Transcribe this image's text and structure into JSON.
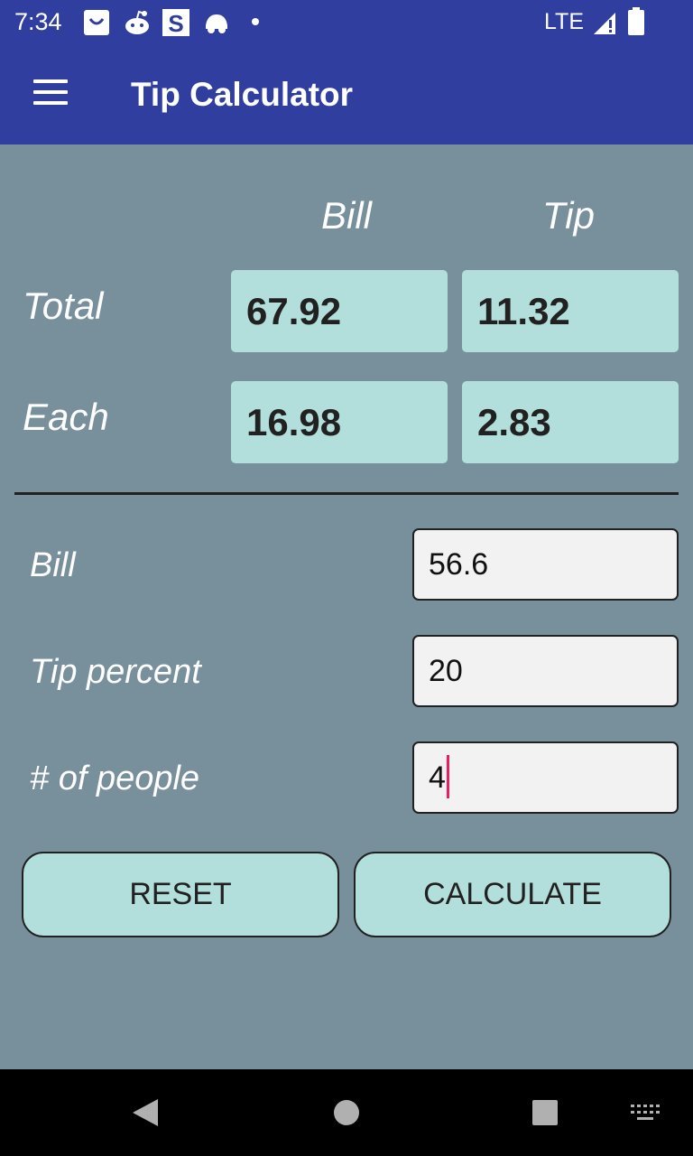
{
  "status_bar": {
    "time": "7:34",
    "notification_icons": [
      "shopping-bag-icon",
      "reddit-icon",
      "s-app-icon",
      "car-icon",
      "dot-icon"
    ],
    "network": "LTE",
    "signal_icon": "signal-icon",
    "battery_icon": "battery-icon"
  },
  "app_bar": {
    "menu_icon": "hamburger-menu-icon",
    "title": "Tip Calculator"
  },
  "results": {
    "col_bill": "Bill",
    "col_tip": "Tip",
    "row_total": "Total",
    "row_each": "Each",
    "total_bill": "67.92",
    "total_tip": "11.32",
    "each_bill": "16.98",
    "each_tip": "2.83"
  },
  "form": {
    "bill_label": "Bill",
    "bill_value": "56.6",
    "tip_percent_label": "Tip percent",
    "tip_percent_value": "20",
    "people_label": "# of people",
    "people_value": "4"
  },
  "buttons": {
    "reset": "RESET",
    "calculate": "CALCULATE"
  },
  "nav_bar": {
    "icons": [
      "back-icon",
      "home-icon",
      "recents-icon",
      "keyboard-icon"
    ]
  },
  "colors": {
    "primary": "#303f9f",
    "background": "#78909c",
    "accent_box": "#b2dfdb",
    "caret": "#e91e63"
  }
}
